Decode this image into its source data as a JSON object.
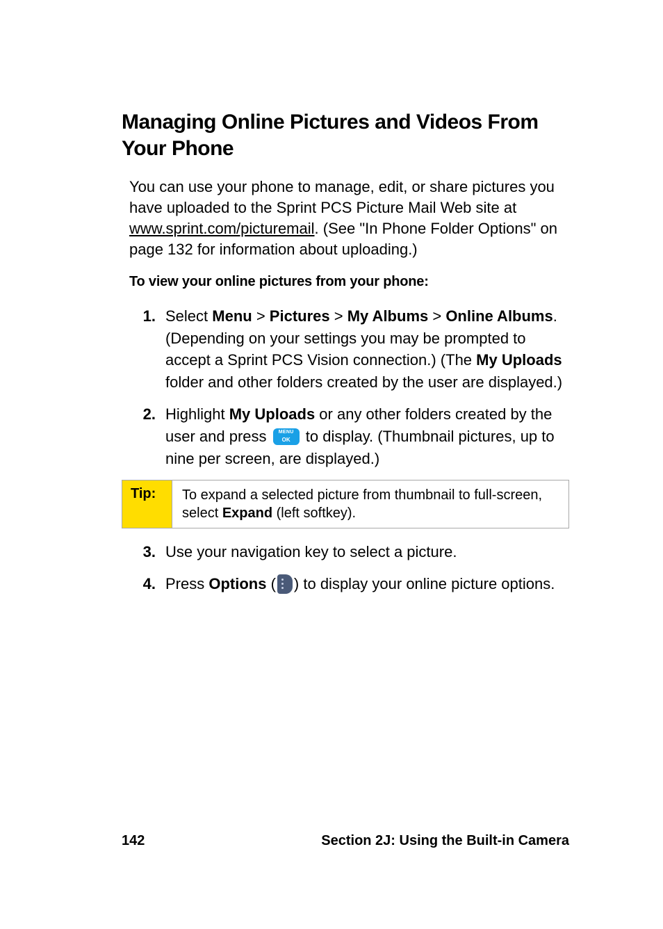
{
  "heading": "Managing Online Pictures and Videos From Your Phone",
  "intro": {
    "pre": "You can use your phone to manage, edit, or share pictures you have uploaded to the Sprint PCS Picture Mail Web site at ",
    "link": "www.sprint.com/picturemail",
    "post": ". (See \"In Phone Folder Options\" on page 132 for information about uploading.)"
  },
  "subhead": "To view your online pictures from your phone:",
  "steps": {
    "s1": {
      "num": "1.",
      "a": "Select ",
      "menu": "Menu",
      "sep": " > ",
      "pictures": "Pictures",
      "myalbums": "My Albums",
      "online": "Online Albums",
      "b": ". (Depending on your settings you may be prompted to accept a Sprint PCS Vision connection.) (The ",
      "uploads": "My Uploads",
      "c": " folder and other folders created by the user are displayed.)"
    },
    "s2": {
      "num": "2.",
      "a": "Highlight ",
      "uploads": "My Uploads",
      "b": " or any other folders created by the user and press ",
      "c": " to display. (Thumbnail pictures, up to nine per screen, are displayed.)"
    },
    "s3": {
      "num": "3.",
      "a": "Use your navigation key to select a picture."
    },
    "s4": {
      "num": "4.",
      "a": "Press ",
      "options": "Options",
      "b": " (",
      "c": ") to display your online picture options."
    }
  },
  "tip": {
    "label": "Tip:",
    "a": "To expand a selected picture from thumbnail to full-screen, select ",
    "expand": "Expand",
    "b": " (left softkey)."
  },
  "footer": {
    "page": "142",
    "section": "Section 2J: Using the Built-in Camera"
  }
}
